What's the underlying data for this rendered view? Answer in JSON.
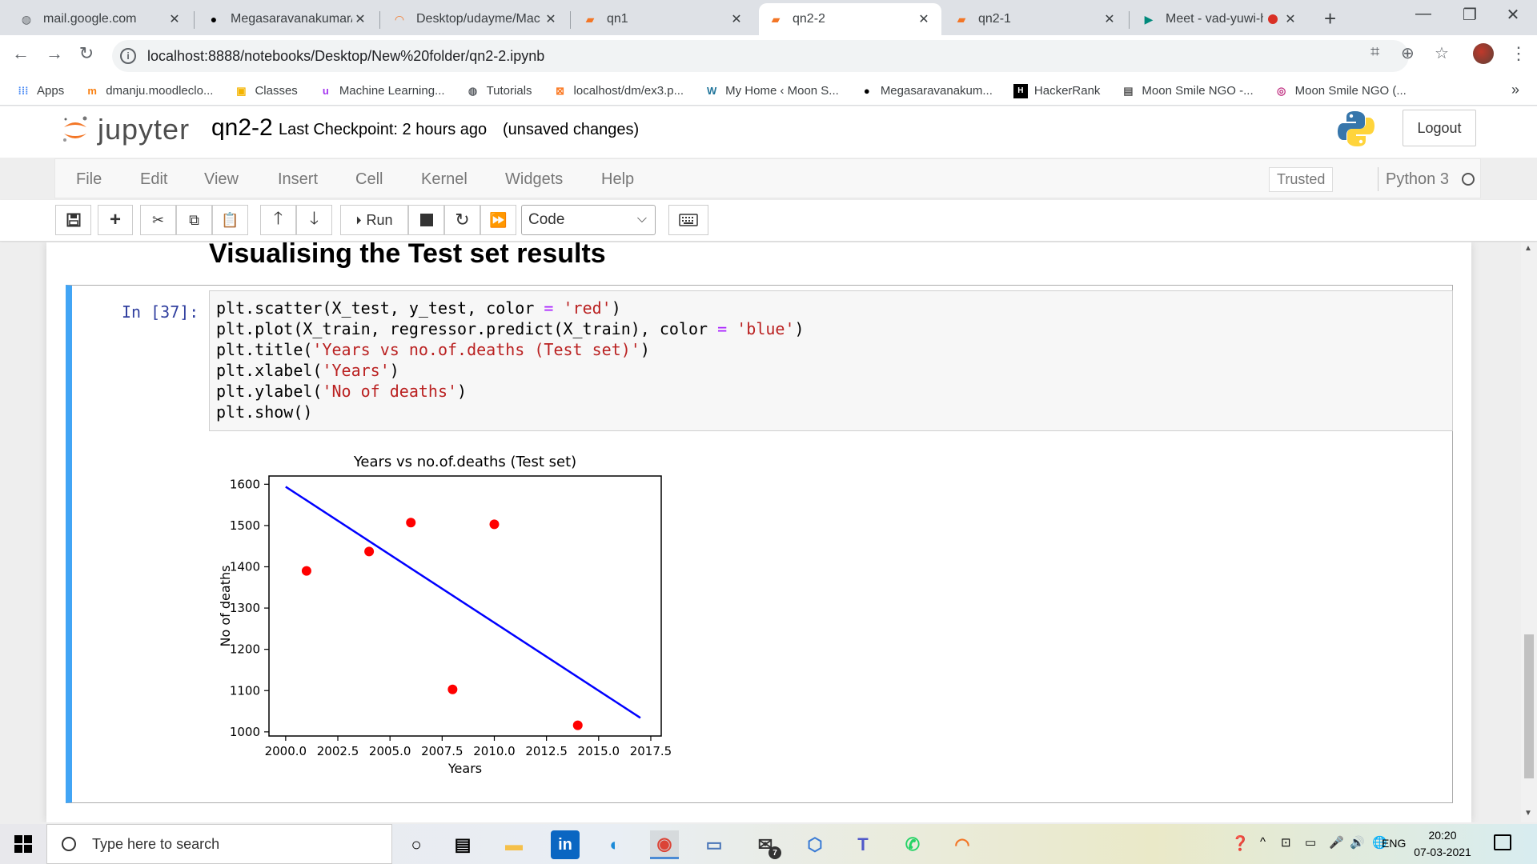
{
  "browser": {
    "tabs": [
      {
        "title": "mail.google.com",
        "icon": "globe-icon",
        "active": false
      },
      {
        "title": "Megasaravanakumar/C",
        "icon": "github-icon",
        "active": false
      },
      {
        "title": "Desktop/udayme/Mac",
        "icon": "jupyter-icon",
        "active": false
      },
      {
        "title": "qn1",
        "icon": "notebook-icon",
        "active": false
      },
      {
        "title": "qn2-2",
        "icon": "notebook-icon",
        "active": true
      },
      {
        "title": "qn2-1",
        "icon": "notebook-icon",
        "active": false
      },
      {
        "title": "Meet - vad-yuwi-h",
        "icon": "meet-icon",
        "active": false
      }
    ],
    "close_glyph": "✕",
    "new_tab_glyph": "+",
    "url": "localhost:8888/notebooks/Desktop/New%20folder/qn2-2.ipynb",
    "bookmarks": [
      {
        "label": "Apps",
        "icon": "apps-grid-icon"
      },
      {
        "label": "dmanju.moodleclo...",
        "icon": "moodle-icon"
      },
      {
        "label": "Classes",
        "icon": "classroom-icon"
      },
      {
        "label": "Machine Learning...",
        "icon": "udemy-icon"
      },
      {
        "label": "Tutorials",
        "icon": "globe-icon"
      },
      {
        "label": "localhost/dm/ex3.p...",
        "icon": "xampp-icon"
      },
      {
        "label": "My Home ‹ Moon S...",
        "icon": "wordpress-icon"
      },
      {
        "label": "Megasaravanakum...",
        "icon": "github-icon"
      },
      {
        "label": "HackerRank",
        "icon": "hackerrank-icon"
      },
      {
        "label": "Moon Smile NGO -...",
        "icon": "page-icon"
      },
      {
        "label": "Moon Smile NGO (...",
        "icon": "instagram-icon"
      }
    ],
    "bookmarks_more": "»"
  },
  "jupyter": {
    "logo_text": "jupyter",
    "notebook_name": "qn2-2",
    "checkpoint": "Last Checkpoint: 2 hours ago",
    "unsaved": "(unsaved changes)",
    "logout": "Logout",
    "menu": [
      "File",
      "Edit",
      "View",
      "Insert",
      "Cell",
      "Kernel",
      "Widgets",
      "Help"
    ],
    "trusted": "Trusted",
    "kernel": "Python 3",
    "toolbar": {
      "run_label": "Run",
      "cell_type": "Code"
    }
  },
  "notebook": {
    "heading": "Visualising the Test set results",
    "cell_prompt": "In [37]:",
    "code_lines": [
      [
        {
          "t": "plt.scatter(X_test, y_test, color "
        },
        {
          "t": "=",
          "c": "o"
        },
        {
          "t": " "
        },
        {
          "t": "'red'",
          "c": "s"
        },
        {
          "t": ")"
        }
      ],
      [
        {
          "t": "plt.plot(X_train, regressor.predict(X_train), color "
        },
        {
          "t": "=",
          "c": "o"
        },
        {
          "t": " "
        },
        {
          "t": "'blue'",
          "c": "s"
        },
        {
          "t": ")"
        }
      ],
      [
        {
          "t": "plt.title("
        },
        {
          "t": "'Years vs no.of.deaths (Test set)'",
          "c": "s"
        },
        {
          "t": ")"
        }
      ],
      [
        {
          "t": "plt.xlabel("
        },
        {
          "t": "'Years'",
          "c": "s"
        },
        {
          "t": ")"
        }
      ],
      [
        {
          "t": "plt.ylabel("
        },
        {
          "t": "'No of deaths'",
          "c": "s"
        },
        {
          "t": ")"
        }
      ],
      [
        {
          "t": "plt.show()"
        }
      ]
    ]
  },
  "chart_data": {
    "type": "scatter",
    "title": "Years vs no.of.deaths (Test set)",
    "xlabel": "Years",
    "ylabel": "No of deaths",
    "xlim": [
      1999.2,
      2018.0
    ],
    "ylim": [
      990,
      1620
    ],
    "xticks": [
      2000.0,
      2002.5,
      2005.0,
      2007.5,
      2010.0,
      2012.5,
      2015.0,
      2017.5
    ],
    "xtick_labels": [
      "2000.0",
      "2002.5",
      "2005.0",
      "2007.5",
      "2010.0",
      "2012.5",
      "2015.0",
      "2017.5"
    ],
    "yticks": [
      1000,
      1100,
      1200,
      1300,
      1400,
      1500,
      1600
    ],
    "ytick_labels": [
      "1000",
      "1100",
      "1200",
      "1300",
      "1400",
      "1500",
      "1600"
    ],
    "grid": false,
    "series": [
      {
        "kind": "scatter",
        "color": "#ff0000",
        "points": [
          [
            2001,
            1390
          ],
          [
            2004,
            1437
          ],
          [
            2006,
            1507
          ],
          [
            2008,
            1103
          ],
          [
            2010,
            1503
          ],
          [
            2014,
            1016
          ]
        ]
      },
      {
        "kind": "line",
        "color": "#0000ff",
        "points": [
          [
            2000,
            1594
          ],
          [
            2017,
            1034
          ]
        ]
      }
    ]
  },
  "taskbar": {
    "search_placeholder": "Type here to search",
    "apps": [
      {
        "icon": "task-view-icon"
      },
      {
        "icon": "widgets-icon"
      },
      {
        "icon": "file-explorer-icon"
      },
      {
        "icon": "linkedin-icon"
      },
      {
        "icon": "edge-icon"
      },
      {
        "icon": "chrome-icon",
        "active": true
      },
      {
        "icon": "remote-desktop-icon"
      },
      {
        "icon": "mail-icon",
        "badge": "7"
      },
      {
        "icon": "3d-box-icon"
      },
      {
        "icon": "teams-icon"
      },
      {
        "icon": "whatsapp-icon"
      },
      {
        "icon": "jupyter-icon"
      }
    ],
    "language": "ENG",
    "time": "20:20",
    "date": "07-03-2021"
  }
}
